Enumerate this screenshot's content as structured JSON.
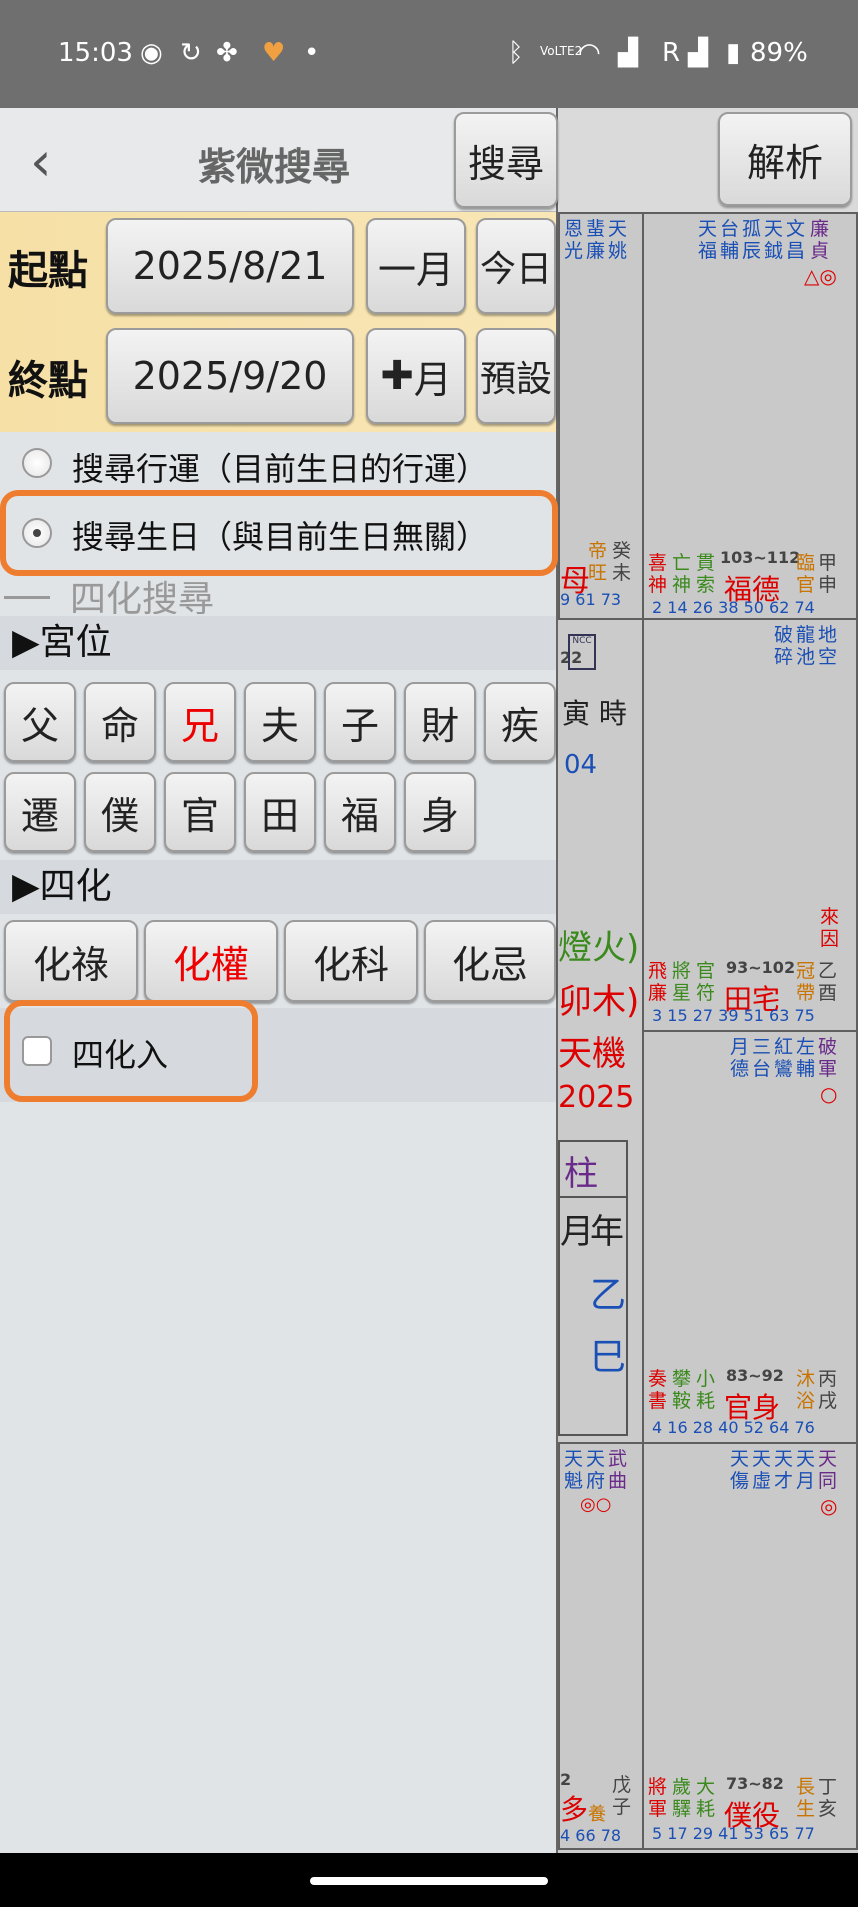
{
  "status": {
    "time": "15:03",
    "battery": "89%",
    "signal_label": "R",
    "volte": "VoLTE2"
  },
  "header": {
    "title": "紫微搜尋",
    "search_label": "搜尋",
    "analyze_label": "解析"
  },
  "date_range": {
    "start_label": "起點",
    "start_value": "2025/8/21",
    "minus_month": "一月",
    "today": "今日",
    "end_label": "終點",
    "end_value": "2025/9/20",
    "plus_month": "月",
    "preset": "預設"
  },
  "search_mode": {
    "option1": "搜尋行運（目前生日的行運）",
    "option2": "搜尋生日（與目前生日無關）",
    "selected": "option2"
  },
  "sihua_search": {
    "title": "四化搜尋"
  },
  "palace_section": {
    "title": "▶宮位",
    "items": [
      "父",
      "命",
      "兄",
      "夫",
      "子",
      "財",
      "疾",
      "遷",
      "僕",
      "官",
      "田",
      "福",
      "身"
    ],
    "highlighted": "兄"
  },
  "sihua_section": {
    "title": "▶四化",
    "items": [
      "化祿",
      "化權",
      "化科",
      "化忌"
    ],
    "highlighted": "化權"
  },
  "sihua_in": {
    "label": "四化入",
    "checked": false
  },
  "chart": {
    "c1_stars_a": "恩光",
    "c1_stars_b": "蜚廉",
    "c1_stars_c": "天姚",
    "c1_ages": "22",
    "c1_bot": "9 61 73",
    "c1_state_a": "帝旺",
    "c1_branch": "癸未",
    "c1_palace": "母",
    "c2_stars": [
      "天福",
      "台輔",
      "孤辰",
      "天鉞",
      "文昌",
      "廉貞"
    ],
    "c2_marks": "△◎",
    "c2_gods": [
      "喜神",
      "亡神",
      "貫索"
    ],
    "c2_range": "103~112",
    "c2_palace": "福德",
    "c2_state": "臨官",
    "c2_branch": "甲申",
    "c2_ages": "2 14 26 38 50 62 74",
    "m_hour_label": "寅 時",
    "m_num": "04",
    "m_fire": "燈火)",
    "m_wood": "卯木)",
    "m_star": "天機",
    "m_year": "2025",
    "m_pillar": "柱",
    "m_col1": "月",
    "m_col2": "年",
    "m_cell1": "乙",
    "m_cell2": "巳",
    "c4_stars": [
      "破碎",
      "龍池",
      "地空"
    ],
    "c4_gods": [
      "飛廉",
      "將星",
      "官符"
    ],
    "c4_range": "93~102",
    "c4_palace": "田宅",
    "c4_state": "冠帶",
    "c4_branch": "乙酉",
    "c4_lai": "來因",
    "c4_ages": "3 15 27 39 51 63 75",
    "c6_stars": [
      "月德",
      "三台",
      "紅鸞",
      "左輔",
      "破軍"
    ],
    "c6_mark": "○",
    "c6_gods": [
      "奏書",
      "攀鞍",
      "小耗"
    ],
    "c6_range": "83~92",
    "c6_palace": "官身",
    "c6_state": "沐浴",
    "c6_branch": "丙戌",
    "c6_ages": "4 16 28 40 52 64 76",
    "c7_stars": [
      "天魁",
      "天府",
      "武曲"
    ],
    "c7_marks": "◎○",
    "c7_ages_num": "2",
    "c7_palace": "多",
    "c7_state": "養",
    "c7_branch": "戊子",
    "c7_bot": "4 66 78",
    "c8_stars": [
      "天傷",
      "天虛",
      "天才",
      "天月",
      "天同"
    ],
    "c8_mark": "◎",
    "c8_gods": [
      "將軍",
      "歲驛",
      "大耗"
    ],
    "c8_range": "73~82",
    "c8_palace": "僕役",
    "c8_state": "長生",
    "c8_branch": "丁亥",
    "c8_ages": "5 17 29 41 53 65 77"
  }
}
